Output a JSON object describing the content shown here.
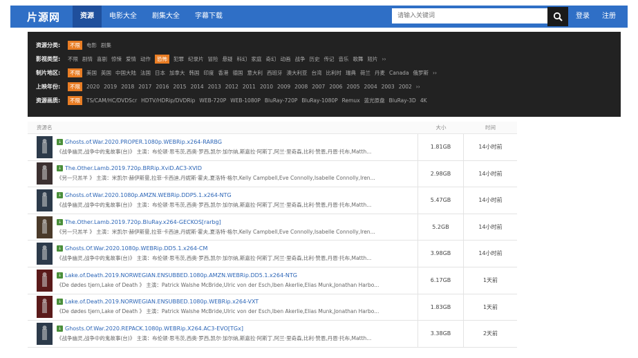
{
  "header": {
    "logo": "片源网",
    "nav": [
      "资源",
      "电影大全",
      "剧集大全",
      "字幕下载"
    ],
    "search_placeholder": "请输入关键词",
    "login": "登录",
    "register": "注册"
  },
  "filters": {
    "type": {
      "label": "资源分类:",
      "items": [
        "不限",
        "电影",
        "剧集"
      ]
    },
    "genre": {
      "label": "影视类型:",
      "items": [
        "不限",
        "剧情",
        "喜剧",
        "惊悚",
        "爱情",
        "动作",
        "恐怖",
        "犯罪",
        "纪录片",
        "冒险",
        "悬疑",
        "科幻",
        "家庭",
        "奇幻",
        "动画",
        "战争",
        "历史",
        "传记",
        "音乐",
        "歌舞",
        "短片",
        "››"
      ]
    },
    "region": {
      "label": "制片地区:",
      "items": [
        "不限",
        "美国",
        "英国",
        "中国大陆",
        "法国",
        "日本",
        "加拿大",
        "韩国",
        "印度",
        "香港",
        "德国",
        "意大利",
        "西班牙",
        "澳大利亚",
        "台湾",
        "比利时",
        "瑞典",
        "荷兰",
        "丹麦",
        "Canada",
        "俄罗斯",
        "››"
      ]
    },
    "year": {
      "label": "上映年份:",
      "items": [
        "不限",
        "2020",
        "2019",
        "2018",
        "2017",
        "2016",
        "2015",
        "2014",
        "2013",
        "2012",
        "2011",
        "2010",
        "2009",
        "2008",
        "2007",
        "2006",
        "2005",
        "2004",
        "2003",
        "2002",
        "››"
      ]
    },
    "quality": {
      "label": "资源画质:",
      "items": [
        "不限",
        "TS/CAM/HC/DVDScr",
        "HDTV/HDRip/DVDRip",
        "WEB-720P",
        "WEB-1080P",
        "BluRay-720P",
        "BluRay-1080P",
        "Remux",
        "蓝光原盘",
        "BluRay-3D",
        "4K"
      ]
    }
  },
  "table": {
    "headers": {
      "name": "资源名",
      "size": "大小",
      "time": "时间"
    },
    "rows": [
      {
        "title": "Ghosts.of.War.2020.PROPER.1080p.WEBRip.x264-RARBG",
        "desc": "《战争幽灵,战争中的鬼故事(台)》 主演：布伦顿·思韦茨,西奥·罗西,凯尔·加尔纳,斯嘉拉·阿斯丁,阿兰·里奇森,比利·赞恩,丹恩·托布,Matth...",
        "size": "1.81GB",
        "time": "14小时前",
        "poster": "#2c3a4a"
      },
      {
        "title": "The.Other.Lamb.2019.720p.BRRip.XviD.AC3-XVID",
        "desc": "《另一只羔羊 》 主演：米凯尔·赫伊斯曼,拉菲·卡西迪,丹妮斯·霍夫,夏洛特·格尔,Kelly Campbell,Eve Connolly,Isabelle Connolly,Iren...",
        "size": "2.98GB",
        "time": "14小时前",
        "poster": "#3b3030"
      },
      {
        "title": "Ghosts.of.War.2020.1080p.AMZN.WEBRip.DDP5.1.x264-NTG",
        "desc": "《战争幽灵,战争中的鬼故事(台)》 主演：布伦顿·思韦茨,西奥·罗西,凯尔·加尔纳,斯嘉拉·阿斯丁,阿兰·里奇森,比利·赞恩,丹恩·托布,Matth...",
        "size": "5.47GB",
        "time": "14小时前",
        "poster": "#2c3a4a"
      },
      {
        "title": "The.Other.Lamb.2019.720p.BluRay.x264-GECKOS[rarbg]",
        "desc": "《另一只羔羊 》 主演：米凯尔·赫伊斯曼,拉菲·卡西迪,丹妮斯·霍夫,夏洛特·格尔,Kelly Campbell,Eve Connolly,Isabelle Connolly,Iren...",
        "size": "5.2GB",
        "time": "14小时前",
        "poster": "#4a3a2a"
      },
      {
        "title": "Ghosts.Of.War.2020.1080p.WEBRip.DD5.1.x264-CM",
        "desc": "《战争幽灵,战争中的鬼故事(台)》 主演：布伦顿·思韦茨,西奥·罗西,凯尔·加尔纳,斯嘉拉·阿斯丁,阿兰·里奇森,比利·赞恩,丹恩·托布,Matth...",
        "size": "3.98GB",
        "time": "14小时前",
        "poster": "#2c3a4a"
      },
      {
        "title": "Lake.of.Death.2019.NORWEGIAN.ENSUBBED.1080p.AMZN.WEBRip.DD5.1.x264-NTG",
        "desc": "《De dødes tjern,Lake of Death 》 主演：Patrick Walshe McBride,Ulric von der Esch,Iben Akerlie,Elias Munk,Jonathan Harbo...",
        "size": "6.17GB",
        "time": "1天前",
        "poster": "#5a1a1a"
      },
      {
        "title": "Lake.of.Death.2019.NORWEGIAN.ENSUBBED.1080p.WEBRip.x264-VXT",
        "desc": "《De dødes tjern,Lake of Death 》 主演：Patrick Walshe McBride,Ulric von der Esch,Iben Akerlie,Elias Munk,Jonathan Harbo...",
        "size": "1.83GB",
        "time": "1天前",
        "poster": "#5a1a1a"
      },
      {
        "title": "Ghosts.Of.War.2020.REPACK.1080p.WEBRip.X264.AC3-EVO[TGx]",
        "desc": "《战争幽灵,战争中的鬼故事(台)》 主演：布伦顿·思韦茨,西奥·罗西,凯尔·加尔纳,斯嘉拉·阿斯丁,阿兰·里奇森,比利·赞恩,丹恩·托布,Matth...",
        "size": "3.38GB",
        "time": "2天前",
        "poster": "#2c3a4a"
      }
    ]
  },
  "colors": {
    "brand": "#2f6fc6",
    "selected": "#e97d24",
    "link": "#2a64b6"
  },
  "icons": {
    "search": "search-icon",
    "download": "download-icon"
  }
}
